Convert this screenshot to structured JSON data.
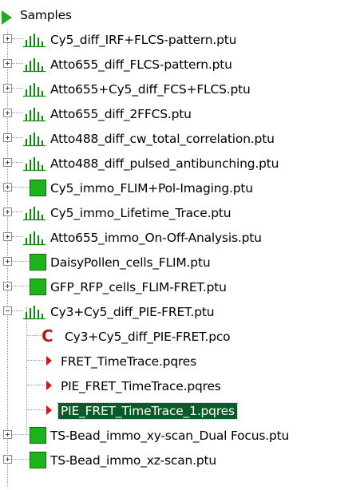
{
  "tree": {
    "root": {
      "label": "Samples",
      "icon": "green-triangle-icon"
    },
    "items": [
      {
        "label": "Cy5_diff_IRF+FLCS-pattern.ptu",
        "icon": "bar-chart-icon",
        "expanded": false
      },
      {
        "label": "Atto655_diff_FLCS-pattern.ptu",
        "icon": "bar-chart-icon",
        "expanded": false
      },
      {
        "label": "Atto655+Cy5_diff_FCS+FLCS.ptu",
        "icon": "bar-chart-icon",
        "expanded": false
      },
      {
        "label": "Atto655_diff_2FFCS.ptu",
        "icon": "bar-chart-icon",
        "expanded": false
      },
      {
        "label": "Atto488_diff_cw_total_correlation.ptu",
        "icon": "bar-chart-icon",
        "expanded": false
      },
      {
        "label": "Atto488_diff_pulsed_antibunching.ptu",
        "icon": "bar-chart-icon",
        "expanded": false
      },
      {
        "label": "Cy5_immo_FLIM+Pol-Imaging.ptu",
        "icon": "green-square-icon",
        "expanded": false
      },
      {
        "label": "Cy5_immo_Lifetime_Trace.ptu",
        "icon": "bar-chart-icon",
        "expanded": false
      },
      {
        "label": "Atto655_immo_On-Off-Analysis.ptu",
        "icon": "bar-chart-icon",
        "expanded": false
      },
      {
        "label": "DaisyPollen_cells_FLIM.ptu",
        "icon": "green-square-icon",
        "expanded": false
      },
      {
        "label": "GFP_RFP_cells_FLIM-FRET.ptu",
        "icon": "green-square-icon",
        "expanded": false
      },
      {
        "label": "Cy3+Cy5_diff_PIE-FRET.ptu",
        "icon": "bar-chart-icon",
        "expanded": true,
        "children": [
          {
            "label": "Cy3+Cy5_diff_PIE-FRET.pco",
            "icon": "red-c-icon"
          },
          {
            "label": "FRET_TimeTrace.pqres",
            "icon": "red-triangle-icon"
          },
          {
            "label": "PIE_FRET_TimeTrace.pqres",
            "icon": "red-triangle-icon"
          },
          {
            "label": "PIE_FRET_TimeTrace_1.pqres",
            "icon": "red-triangle-icon",
            "selected": true
          }
        ]
      },
      {
        "label": "TS-Bead_immo_xy-scan_Dual Focus.ptu",
        "icon": "green-square-icon",
        "expanded": false
      },
      {
        "label": "TS-Bead_immo_xz-scan.ptu",
        "icon": "green-square-icon",
        "expanded": false
      }
    ]
  },
  "colors": {
    "green": "#1db31d",
    "red": "#d4141a",
    "selection": "#0b5a2a"
  }
}
